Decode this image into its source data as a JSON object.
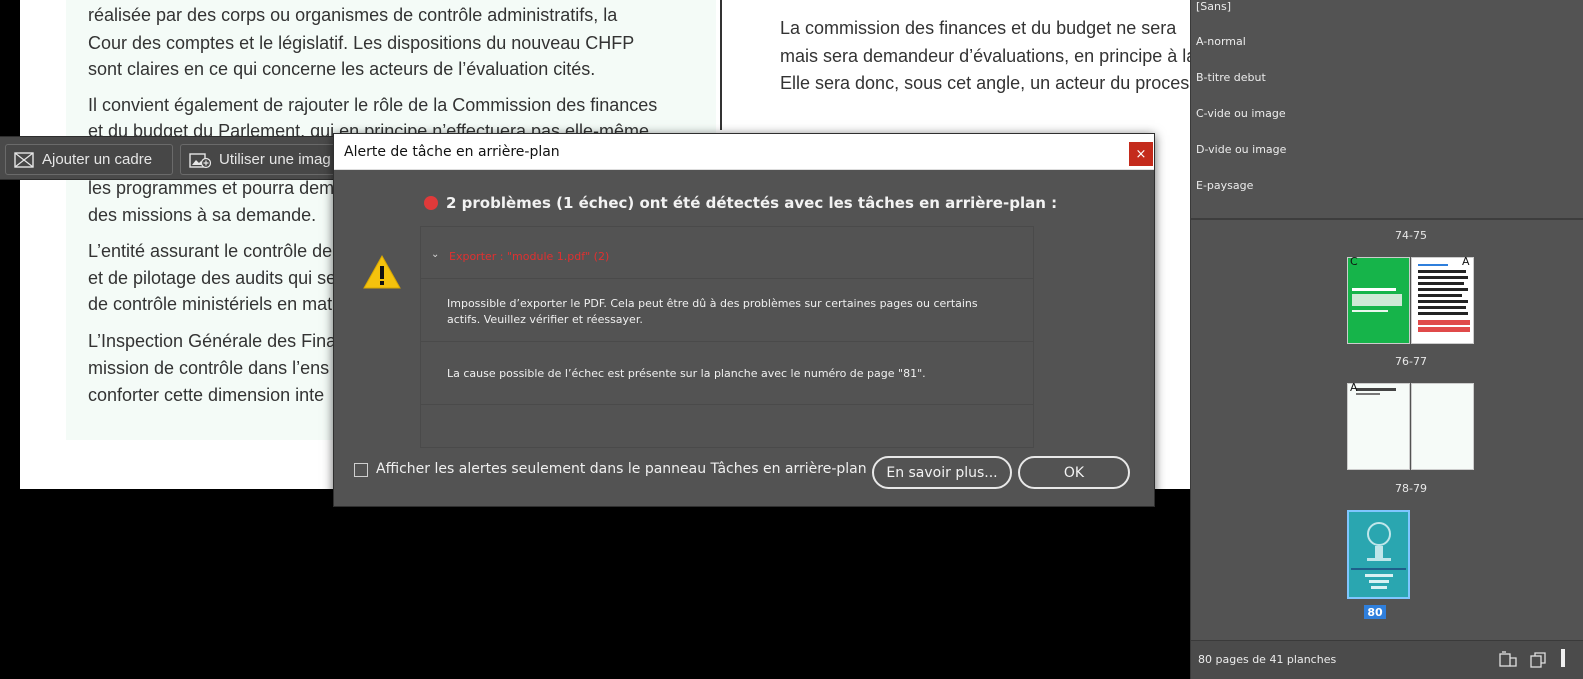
{
  "document": {
    "left_column_lines": [
      "réalisée par des corps ou organismes de contrôle administratifs, la",
      "Cour des comptes et le législatif. Les dispositions du nouveau CHFP",
      "sont claires en ce qui concerne les acteurs de l’évaluation cités.",
      "Il convient également de rajouter le rôle de la Commission des finances",
      "et du budget du Parlement, qui en principe n’effectuera pas elle-même",
      "les programmes et pourra dem",
      "des missions à sa demande.",
      "L’entité assurant le contrôle de l’",
      "et de pilotage des audits qui sero",
      "de contrôle ministériels en mat",
      "L’Inspection Générale des Fina",
      "mission de contrôle dans l’ens",
      "conforter cette dimension inte"
    ],
    "right_column_lines": [
      "La commission des finances et du budget ne sera",
      "mais sera demandeur d’évaluations, en principe à la",
      "Elle sera donc, sous cet angle, un acteur du process"
    ]
  },
  "frame_toolbar": {
    "add_frame_label": "Ajouter un cadre",
    "use_image_label": "Utiliser une imag"
  },
  "dialog": {
    "title": "Alerte de tâche en arrière-plan",
    "close_label": "×",
    "heading": "2 problèmes (1 échec) ont été détectés avec les tâches en arrière-plan :",
    "issue_header": "Exporter : \"module 1.pdf\" (2)",
    "issues": [
      "Impossible d’exporter le PDF. Cela peut être dû à des problèmes sur certaines pages ou certains actifs. Veuillez vérifier et réessayer.",
      "La cause possible de l’échec est présente sur la planche avec le numéro de page \"81\"."
    ],
    "checkbox_label": "Afficher les alertes seulement dans le panneau Tâches en arrière-plan",
    "learn_more_label": "En savoir plus...",
    "ok_label": "OK"
  },
  "pages_panel": {
    "masters": [
      "[Sans]",
      "A-normal",
      "B-titre debut",
      "C-vide ou image",
      "D-vide ou image",
      "E-paysage"
    ],
    "spreads": [
      {
        "label": "74-75",
        "left_prefix": "C",
        "right_prefix": "A"
      },
      {
        "label": "76-77",
        "left_prefix": "A",
        "right_prefix": ""
      },
      {
        "label": "78-79",
        "left_prefix": "",
        "right_prefix": ""
      }
    ],
    "current_page": "80",
    "footer_text": "80 pages de 41 planches"
  },
  "colors": {
    "dialog_bg": "#535353",
    "error_red": "#e03030",
    "thumbnail_green": "#16b44a",
    "thumbnail_teal": "#2aa6b0",
    "page_badge_blue": "#2f7fdc"
  }
}
